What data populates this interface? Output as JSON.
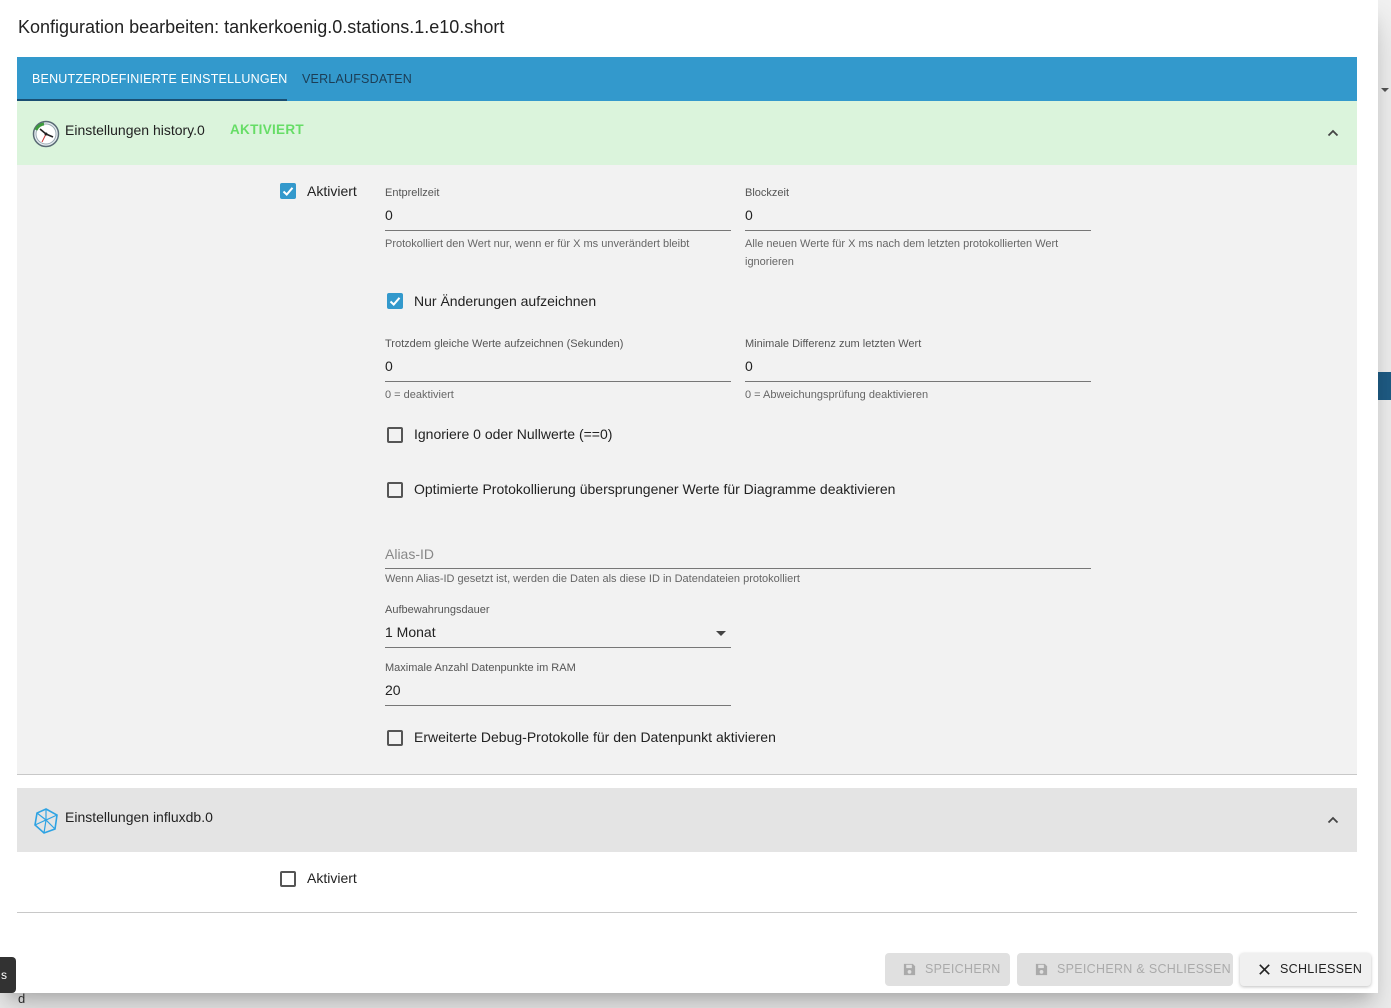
{
  "dialog": {
    "title": "Konfiguration bearbeiten: tankerkoenig.0.stations.1.e10.short"
  },
  "tabs": [
    {
      "label": "Benutzerdefinierte Einstellungen",
      "active": true
    },
    {
      "label": "Verlaufsdaten",
      "active": false
    }
  ],
  "history": {
    "title": "Einstellungen history.0",
    "badge": "AKTIVIERT",
    "icon": "history-clock-icon",
    "enabled_label": "Aktiviert",
    "enabled": true,
    "debounce": {
      "label": "Entprellzeit",
      "value": "0",
      "help": "Protokolliert den Wert nur, wenn er für X ms unverändert bleibt"
    },
    "blocktime": {
      "label": "Blockzeit",
      "value": "0",
      "help": "Alle neuen Werte für X ms nach dem letzten protokollierten Wert ignorieren"
    },
    "changes_only": {
      "label": "Nur Änderungen aufzeichnen",
      "checked": true
    },
    "change_interval": {
      "label": "Trotzdem gleiche Werte aufzeichnen (Sekunden)",
      "value": "0",
      "help": "0 = deaktiviert"
    },
    "min_diff": {
      "label": "Minimale Differenz zum letzten Wert",
      "value": "0",
      "help": "0 = Abweichungsprüfung deaktivieren"
    },
    "ignore_zero": {
      "label": "Ignoriere 0 oder Nullwerte (==0)",
      "checked": false
    },
    "disable_skipped": {
      "label": "Optimierte Protokollierung übersprungener Werte für Diagramme deaktivieren",
      "checked": false
    },
    "alias": {
      "placeholder": "Alias-ID",
      "help": "Wenn Alias-ID gesetzt ist, werden die Daten als diese ID in Datendateien protokolliert"
    },
    "retention": {
      "label": "Aufbewahrungsdauer",
      "value": "1 Monat"
    },
    "max_length": {
      "label": "Maximale Anzahl Datenpunkte im RAM",
      "value": "20"
    },
    "debug": {
      "label": "Erweiterte Debug-Protokolle für den Datenpunkt aktivieren",
      "checked": false
    }
  },
  "influx": {
    "title": "Einstellungen influxdb.0",
    "icon": "influxdb-icon",
    "enabled_label": "Aktiviert",
    "enabled": false
  },
  "buttons": {
    "save": "Speichern",
    "save_close": "Speichern & Schließen",
    "close": "Schließen"
  },
  "colors": {
    "accent": "#3399cc",
    "history_header": "#dbf4dc",
    "badge": "#66dd66"
  }
}
